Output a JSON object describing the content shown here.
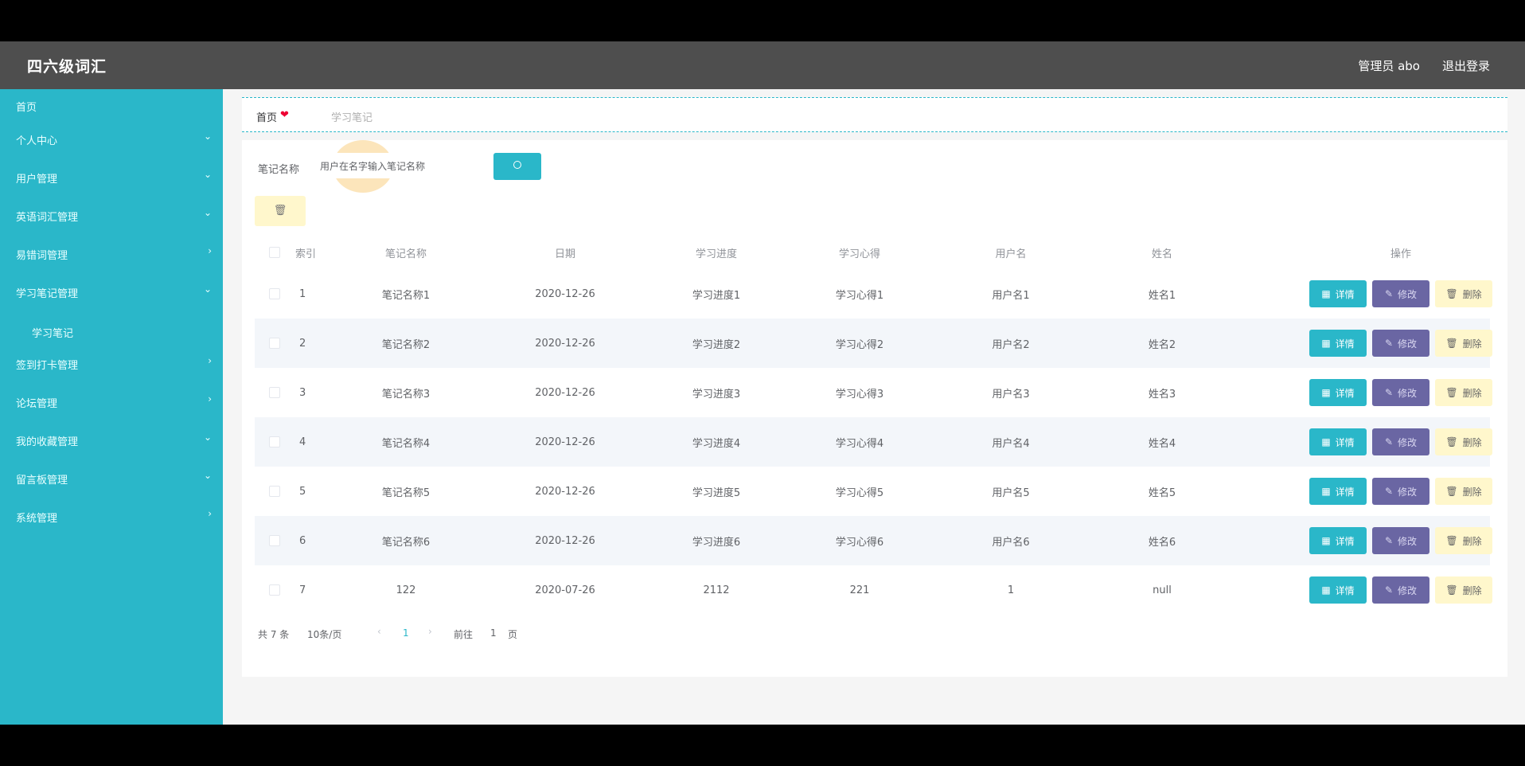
{
  "header": {
    "title": "四六级词汇",
    "user_label": "管理员 abo",
    "logout_label": "退出登录"
  },
  "sidebar": {
    "items": [
      {
        "label": "首页",
        "chevron": ""
      },
      {
        "label": "个人中心",
        "chevron": "⌄"
      },
      {
        "label": "用户管理",
        "chevron": "⌄"
      },
      {
        "label": "英语词汇管理",
        "chevron": "⌄"
      },
      {
        "label": "易错词管理",
        "chevron": "›"
      },
      {
        "label": "学习笔记管理",
        "chevron": "⌄"
      },
      {
        "label": "学习笔记",
        "chevron": ""
      },
      {
        "label": "签到打卡管理",
        "chevron": "›"
      },
      {
        "label": "论坛管理",
        "chevron": "›"
      },
      {
        "label": "我的收藏管理",
        "chevron": "⌄"
      },
      {
        "label": "留言板管理",
        "chevron": "⌄"
      },
      {
        "label": "系统管理",
        "chevron": "›"
      }
    ]
  },
  "breadcrumb": {
    "home": "首页",
    "separator": "❤",
    "current": "学习笔记"
  },
  "search": {
    "label": "笔记名称",
    "value": "用户在名字输入笔记名称",
    "placeholder": "笔记名称"
  },
  "table": {
    "headers": [
      "索引",
      "笔记名称",
      "日期",
      "学习进度",
      "学习心得",
      "用户名",
      "姓名",
      "操作"
    ],
    "rows": [
      {
        "index": "1",
        "name": "笔记名称1",
        "date": "2020-12-26",
        "progress": "学习进度1",
        "insight": "学习心得1",
        "username": "用户名1",
        "realname": "姓名1"
      },
      {
        "index": "2",
        "name": "笔记名称2",
        "date": "2020-12-26",
        "progress": "学习进度2",
        "insight": "学习心得2",
        "username": "用户名2",
        "realname": "姓名2"
      },
      {
        "index": "3",
        "name": "笔记名称3",
        "date": "2020-12-26",
        "progress": "学习进度3",
        "insight": "学习心得3",
        "username": "用户名3",
        "realname": "姓名3"
      },
      {
        "index": "4",
        "name": "笔记名称4",
        "date": "2020-12-26",
        "progress": "学习进度4",
        "insight": "学习心得4",
        "username": "用户名4",
        "realname": "姓名4"
      },
      {
        "index": "5",
        "name": "笔记名称5",
        "date": "2020-12-26",
        "progress": "学习进度5",
        "insight": "学习心得5",
        "username": "用户名5",
        "realname": "姓名5"
      },
      {
        "index": "6",
        "name": "笔记名称6",
        "date": "2020-12-26",
        "progress": "学习进度6",
        "insight": "学习心得6",
        "username": "用户名6",
        "realname": "姓名6"
      },
      {
        "index": "7",
        "name": "122",
        "date": "2020-07-26",
        "progress": "2112",
        "insight": "221",
        "username": "1",
        "realname": "null"
      }
    ],
    "actions": {
      "detail": "详情",
      "edit": "修改",
      "delete": "删除"
    }
  },
  "pagination": {
    "total": "共 7 条",
    "page_size": "10条/页",
    "prev": "‹",
    "current_page": "1",
    "next": "›",
    "goto_label": "前往",
    "goto_value": "1",
    "page_suffix": "页"
  },
  "colors": {
    "accent": "#2ab7c9",
    "header_bg": "#4e4e4e",
    "edit_button": "#6a66a3",
    "delete_button": "#fff7cc"
  }
}
